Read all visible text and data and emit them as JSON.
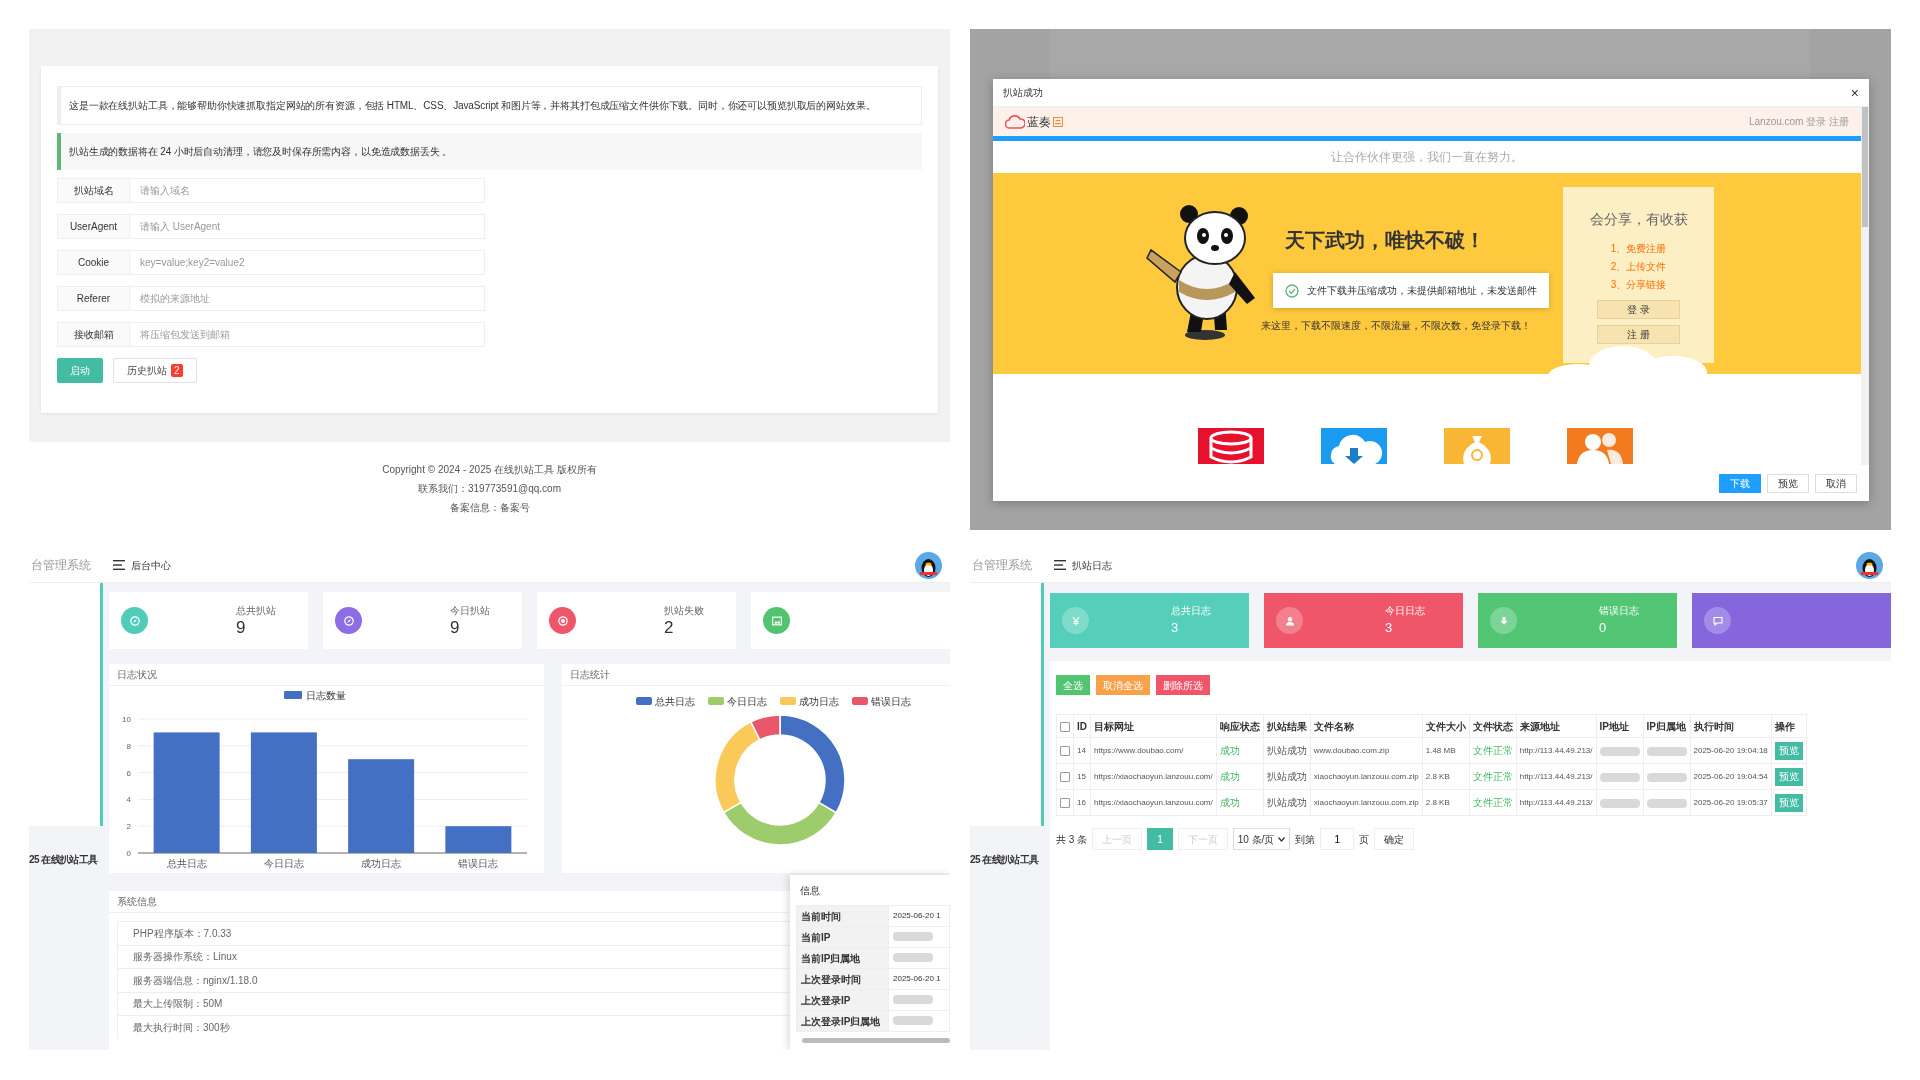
{
  "scraper_page": {
    "notices": [
      {
        "kind": "info",
        "text": "这是一款在线扒站工具，能够帮助你快速抓取指定网站的所有资源，包括 HTML、CSS、JavaScript 和图片等，并将其打包成压缩文件供你下载。同时，你还可以预览扒取后的网站效果。"
      },
      {
        "kind": "tip",
        "text": "扒站生成的数据将在 24 小时后自动清理，请您及时保存所需内容，以免造成数据丢失 。"
      }
    ],
    "fields": [
      {
        "label": "扒站域名",
        "placeholder": "请输入域名"
      },
      {
        "label": "UserAgent",
        "placeholder": "请输入 UserAgent"
      },
      {
        "label": "Cookie",
        "placeholder": "key=value;key2=value2"
      },
      {
        "label": "Referer",
        "placeholder": "模拟的来源地址"
      },
      {
        "label": "接收邮箱",
        "placeholder": "将压缩包发送到邮箱"
      }
    ],
    "start_button": "启动",
    "history_button": "历史扒站",
    "history_badge": "2",
    "footer": [
      "Copyright © 2024 - 2025 在线扒站工具 版权所有",
      "联系我们：319773591@qq.com",
      "备案信息：备案号"
    ]
  },
  "success_dialog": {
    "title": "扒站成功",
    "close": "×",
    "embedded_page": {
      "logo": "蓝奏",
      "header_links": "Lanzou.com 登录 注册",
      "tagline": "让合作伙伴更强，我们一直在努力。",
      "headline": "天下武功，唯快不破！",
      "subline": "来这里，下载不限速度，不限流量，不限次数，免登录下载！",
      "side_title": "会分享，有收获",
      "side_steps": [
        "1、免费注册",
        "2、上传文件",
        "3、分享链接"
      ],
      "side_buttons": [
        "登 录",
        "注 册"
      ]
    },
    "toast": "文件下载并压缩成功，未提供邮箱地址，未发送邮件",
    "buttons": [
      {
        "label": "下载",
        "primary": true
      },
      {
        "label": "预览",
        "primary": false
      },
      {
        "label": "取消",
        "primary": false
      }
    ]
  },
  "admin_dashboard": {
    "brand": "台管理系统",
    "sidebar_footer": "25 在线扒站工具",
    "page_title": "后台中心",
    "stats": [
      {
        "label": "总共扒站",
        "value": "9",
        "color": "#4fcdb9"
      },
      {
        "label": "今日扒站",
        "value": "9",
        "color": "#8c6de4"
      },
      {
        "label": "扒站失败",
        "value": "2",
        "color": "#f0566a"
      },
      {
        "color": "#52c46f"
      }
    ],
    "bar_panel": {
      "title": "日志状况",
      "chart_data": {
        "type": "bar",
        "categories": [
          "总共日志",
          "今日日志",
          "成功日志",
          "错误日志"
        ],
        "series": [
          {
            "name": "日志数量",
            "color": "#4470c4",
            "values": [
              9,
              9,
              7,
              2
            ]
          }
        ],
        "ylim": [
          0,
          10
        ],
        "yticks": [
          0,
          2,
          4,
          6,
          8,
          10
        ],
        "grid": true,
        "legend": true
      }
    },
    "donut_panel": {
      "title": "日志统计",
      "chart_data": {
        "type": "donut",
        "categories": [
          "总共日志",
          "今日日志",
          "成功日志",
          "错误日志"
        ],
        "values": [
          33.4,
          33.3,
          25.9,
          7.4
        ],
        "legend": true
      }
    },
    "system_info": {
      "title": "系统信息",
      "rows": [
        "PHP程序版本：7.0.33",
        "服务器操作系统：Linux",
        "服务器端信息：nginx/1.18.0",
        "最大上传限制：50M",
        "最大执行时间：300秒"
      ]
    },
    "info_popup": {
      "title": "信息",
      "rows": [
        {
          "label": "当前时间",
          "value": "2025-06-20 1"
        },
        {
          "label": "当前IP"
        },
        {
          "label": "当前IP归属地"
        },
        {
          "label": "上次登录时间",
          "value": "2025-06-20 1"
        },
        {
          "label": "上次登录IP"
        },
        {
          "label": "上次登录IP归属地"
        }
      ]
    }
  },
  "log_page": {
    "brand": "台管理系统",
    "sidebar_footer": "25 在线扒站工具",
    "page_title": "扒站日志",
    "stats": [
      {
        "label": "总共日志",
        "value": "3",
        "color": "#55cfb9"
      },
      {
        "label": "今日日志",
        "value": "3",
        "color": "#f0566a"
      },
      {
        "label": "错误日志",
        "value": "0",
        "color": "#52c674"
      },
      {
        "color": "#8566dd"
      }
    ],
    "actions": [
      {
        "label": "全选",
        "color": "#52c46f"
      },
      {
        "label": "取消全选",
        "color": "#f7a14b"
      },
      {
        "label": "删除所选",
        "color": "#f0566a"
      }
    ],
    "table": {
      "header_checked": false,
      "columns": [
        "ID",
        "目标网址",
        "响应状态",
        "扒站结果",
        "文件名称",
        "文件大小",
        "文件状态",
        "来源地址",
        "IP地址",
        "IP归属地",
        "执行时间",
        "操作"
      ],
      "rows": [
        {
          "checked": false,
          "cells": [
            "14",
            "https://www.doubao.com/",
            "成功",
            "扒站成功",
            "www.doubao.com.zip",
            "1.48 MB",
            "文件正常",
            "http://113.44.49.213/",
            null,
            null,
            "2025-06-20 19:04:18",
            "预览"
          ]
        },
        {
          "checked": false,
          "cells": [
            "15",
            "https://xiaochaoyun.lanzouu.com/",
            "成功",
            "扒站成功",
            "xiaochaoyun.lanzouu.com.zip",
            "2.8 KB",
            "文件正常",
            "http://113.44.49.213/",
            null,
            null,
            "2025-06-20 19:04:54",
            "预览"
          ]
        },
        {
          "checked": false,
          "cells": [
            "16",
            "https://xiaochaoyun.lanzouu.com/",
            "成功",
            "扒站成功",
            "xiaochaoyun.lanzouu.com.zip",
            "2.8 KB",
            "文件正常",
            "http://113.44.49.213/",
            null,
            null,
            "2025-06-20 19:05:37",
            "预览"
          ]
        }
      ]
    },
    "pagination": {
      "total": "共 3 条",
      "prev": {
        "label": "上一页",
        "disabled": true
      },
      "pages": [
        {
          "label": "1",
          "selected": true
        }
      ],
      "next": {
        "label": "下一页",
        "disabled": true
      },
      "page_size": "10 条/页",
      "goto_prefix": "到第",
      "goto_value": "1",
      "goto_suffix": "页",
      "confirm": "确定"
    }
  }
}
